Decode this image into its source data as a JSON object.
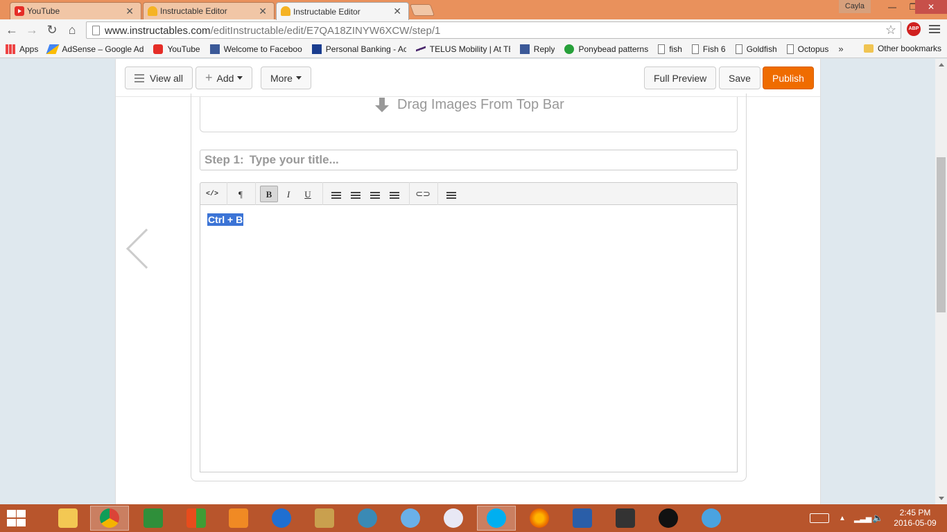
{
  "browser": {
    "tabs": [
      {
        "label": "YouTube",
        "icon": "youtube-icon",
        "active": false
      },
      {
        "label": "Instructable Editor",
        "icon": "instructables-icon",
        "active": false
      },
      {
        "label": "Instructable Editor",
        "icon": "instructables-icon",
        "active": true
      }
    ],
    "user": "Cayla",
    "url_host": "www.instructables.com",
    "url_path": "/editInstructable/edit/E7QA18ZINYW6XCW/step/1",
    "abp_label": "ABP"
  },
  "bookmarks": {
    "items": [
      {
        "label": "Apps",
        "icon": "apps-icon"
      },
      {
        "label": "AdSense – Google Ad",
        "icon": "adsense-icon"
      },
      {
        "label": "YouTube",
        "icon": "youtube-icon"
      },
      {
        "label": "Welcome to Faceboo",
        "icon": "facebook-icon"
      },
      {
        "label": "Personal Banking - Ac",
        "icon": "bank-icon"
      },
      {
        "label": "TELUS Mobility | At TE",
        "icon": "telus-icon"
      },
      {
        "label": "Reply",
        "icon": "facebook-icon"
      },
      {
        "label": "Ponybead patterns",
        "icon": "ponybead-icon"
      },
      {
        "label": "fish",
        "icon": "page-icon"
      },
      {
        "label": "Fish 6",
        "icon": "page-icon"
      },
      {
        "label": "Goldfish",
        "icon": "page-icon"
      },
      {
        "label": "Octopus",
        "icon": "page-icon"
      }
    ],
    "more": "»",
    "other": "Other bookmarks"
  },
  "editor": {
    "view_all": "View all",
    "add": "Add",
    "more": "More",
    "full_preview": "Full Preview",
    "save": "Save",
    "publish": "Publish",
    "drop_zone": "Drag Images From Top Bar",
    "step_prefix": "Step 1:",
    "title_placeholder": "Type your title...",
    "body_selected_text": "Ctrl + B",
    "toolbar": {
      "code": "</>",
      "paragraph": "¶",
      "bold": "B",
      "italic": "I",
      "underline": "U"
    }
  },
  "taskbar": {
    "time": "2:45 PM",
    "date": "2016-05-09"
  },
  "colors": {
    "publish": "#ef6c00",
    "tabstrip": "#e9915c",
    "taskbar": "#b8552c",
    "selection": "#3c74d6"
  }
}
